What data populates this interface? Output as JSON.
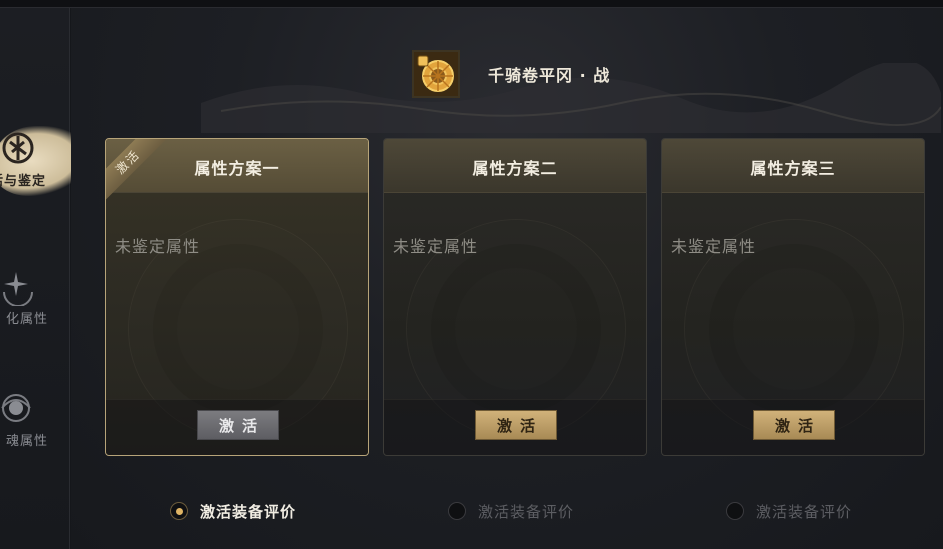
{
  "header": {
    "equipment_name": "千骑卷平冈 · 战",
    "equipment_icon": "gold-wheel-lock-icon"
  },
  "sidebar": {
    "items": [
      {
        "label": "活与鉴定",
        "icon": "seal-icon",
        "active": true
      },
      {
        "label": "化属性",
        "icon": "sparkle-moon-icon",
        "active": false
      },
      {
        "label": "魂属性",
        "icon": "spirit-orb-icon",
        "active": false
      }
    ]
  },
  "cards": [
    {
      "title": "属性方案一",
      "status": "未鉴定属性",
      "button": "激活",
      "ribbon": "激活",
      "active": true
    },
    {
      "title": "属性方案二",
      "status": "未鉴定属性",
      "button": "激活",
      "active": false
    },
    {
      "title": "属性方案三",
      "status": "未鉴定属性",
      "button": "激活",
      "active": false
    }
  ],
  "evaluation": [
    {
      "label": "激活装备评价",
      "selected": true
    },
    {
      "label": "激活装备评价",
      "selected": false
    },
    {
      "label": "激活装备评价",
      "selected": false
    }
  ],
  "colors": {
    "accent_gold": "#d1b27a",
    "active_border": "#b7a479",
    "background": "#17191d",
    "radio_on": "#e0b565"
  }
}
